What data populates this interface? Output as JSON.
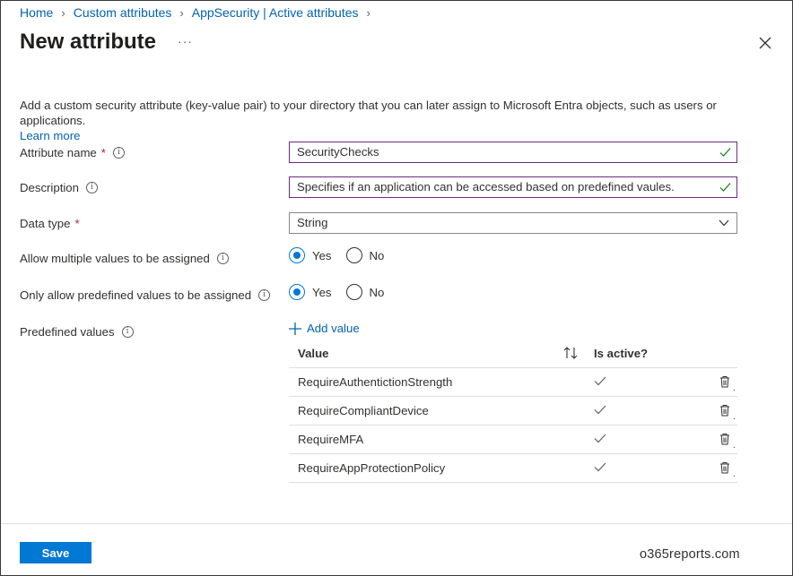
{
  "breadcrumb": [
    "Home",
    "Custom attributes",
    "AppSecurity | Active attributes"
  ],
  "title": "New attribute",
  "more_label": "···",
  "description_text": "Add a custom security attribute (key-value pair) to your directory that you can later assign to Microsoft Entra objects, such as users or applications.",
  "learn_more": "Learn more",
  "fields": {
    "attribute_name": {
      "label": "Attribute name",
      "required": "*",
      "value": "SecurityChecks"
    },
    "description": {
      "label": "Description",
      "value": "Specifies if an application can be accessed based on predefined vaules."
    },
    "data_type": {
      "label": "Data type",
      "required": "*",
      "value": "String"
    },
    "multiple_values": {
      "label": "Allow multiple values to be assigned",
      "yes": "Yes",
      "no": "No",
      "selected": "Yes"
    },
    "predefined_only": {
      "label": "Only allow predefined values to be assigned",
      "yes": "Yes",
      "no": "No",
      "selected": "Yes"
    },
    "predefined_values": {
      "label": "Predefined values"
    }
  },
  "add_value": "Add value",
  "table": {
    "columns": [
      "Value",
      "Is active?"
    ],
    "rows": [
      {
        "value": "RequireAuthentictionStrength",
        "active": true
      },
      {
        "value": "RequireCompliantDevice",
        "active": true
      },
      {
        "value": "RequireMFA",
        "active": true
      },
      {
        "value": "RequireAppProtectionPolicy",
        "active": true
      }
    ]
  },
  "save_label": "Save",
  "watermark": "o365reports.com",
  "colors": {
    "accent": "#0078d4",
    "link": "#0063b1",
    "valid_border": "#6b2c82",
    "valid_check": "#107c10",
    "required": "#a4262c"
  },
  "icons": [
    "chevron-right-icon",
    "close-icon",
    "info-icon",
    "checkmark-icon",
    "chevron-down-icon",
    "plus-icon",
    "sort-icon",
    "trash-icon"
  ]
}
